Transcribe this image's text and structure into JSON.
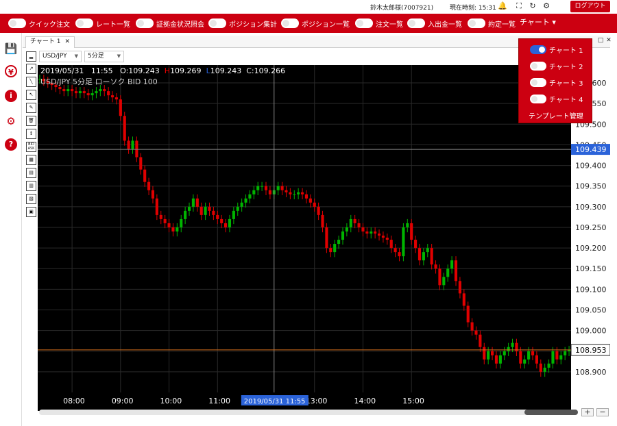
{
  "topbar": {
    "user": "鈴木太郎様(7007921)",
    "time": "現在時刻: 15:31",
    "logout_label": "ログアウト"
  },
  "navbar": {
    "items": [
      {
        "label": "クイック注文"
      },
      {
        "label": "レート一覧"
      },
      {
        "label": "証拠金状況照会"
      },
      {
        "label": "ポジション集計"
      },
      {
        "label": "ポジション一覧"
      },
      {
        "label": "注文一覧"
      },
      {
        "label": "入出金一覧"
      },
      {
        "label": "約定一覧"
      }
    ],
    "chart_menu_label": "チャート"
  },
  "tabs": [
    {
      "label": "チャート 1"
    }
  ],
  "symbol": {
    "pair": "USD/JPY",
    "timeframe": "5分足"
  },
  "ohlc": {
    "date": "2019/05/31",
    "time": "11:55",
    "open": "O:109.243",
    "high": "109.269",
    "low": "109.243",
    "close": "C:109.266",
    "high_marker": "H",
    "low_marker": "L"
  },
  "caption": "USD/JPY  5分足  ローソク  BID  100",
  "tools": [
    "trend",
    "line",
    "cursor",
    "eraser",
    "trash",
    "adjust",
    "BID ASK",
    "grid1",
    "grid2",
    "grid3",
    "grid4",
    "panel"
  ],
  "dropdown": {
    "items": [
      {
        "label": "チャート 1",
        "on": true
      },
      {
        "label": "チャート 2",
        "on": false
      },
      {
        "label": "チャート 3",
        "on": false
      },
      {
        "label": "チャート 4",
        "on": false
      }
    ],
    "template_label": "テンプレート管理"
  },
  "colors": {
    "brand": "#cc0011",
    "up": "#00b400",
    "down": "#e00000",
    "accent": "#2b63d9"
  },
  "chart_data": {
    "type": "candlestick",
    "ylim": [
      108.85,
      109.62
    ],
    "yticks": [
      "109.600",
      "109.550",
      "109.500",
      "109.450",
      "109.400",
      "109.350",
      "109.300",
      "109.250",
      "109.200",
      "109.150",
      "109.100",
      "109.050",
      "109.000",
      "108.950",
      "108.900"
    ],
    "xticks": [
      "08:00",
      "09:00",
      "10:00",
      "11:00",
      "13:00",
      "14:00",
      "15:00"
    ],
    "crosshair": {
      "time_label": "2019/05/31 11:55",
      "price_label": "109.439"
    },
    "current_price_label": "108.953",
    "closes": [
      109.61,
      109.605,
      109.6,
      109.595,
      109.59,
      109.585,
      109.58,
      109.585,
      109.58,
      109.575,
      109.58,
      109.575,
      109.57,
      109.575,
      109.58,
      109.585,
      109.58,
      109.57,
      109.565,
      109.56,
      109.52,
      109.46,
      109.44,
      109.46,
      109.42,
      109.39,
      109.36,
      109.34,
      109.32,
      109.28,
      109.27,
      109.26,
      109.25,
      109.24,
      109.25,
      109.27,
      109.29,
      109.3,
      109.32,
      109.3,
      109.28,
      109.3,
      109.29,
      109.28,
      109.27,
      109.26,
      109.25,
      109.27,
      109.29,
      109.3,
      109.31,
      109.32,
      109.33,
      109.34,
      109.35,
      109.35,
      109.34,
      109.33,
      109.34,
      109.35,
      109.34,
      109.335,
      109.33,
      109.33,
      109.335,
      109.33,
      109.32,
      109.31,
      109.3,
      109.28,
      109.25,
      109.2,
      109.19,
      109.21,
      109.22,
      109.24,
      109.25,
      109.27,
      109.26,
      109.25,
      109.24,
      109.235,
      109.24,
      109.235,
      109.23,
      109.225,
      109.22,
      109.2,
      109.19,
      109.18,
      109.25,
      109.26,
      109.22,
      109.2,
      109.17,
      109.19,
      109.2,
      109.16,
      109.15,
      109.11,
      109.13,
      109.15,
      109.17,
      109.12,
      109.09,
      109.06,
      109.02,
      109.0,
      108.99,
      108.96,
      108.93,
      108.95,
      108.94,
      108.92,
      108.94,
      108.95,
      108.96,
      108.97,
      108.95,
      108.92,
      108.93,
      108.95,
      108.94,
      108.92,
      108.9,
      108.91,
      108.92,
      108.95,
      108.93,
      108.94,
      108.95,
      108.953
    ]
  }
}
